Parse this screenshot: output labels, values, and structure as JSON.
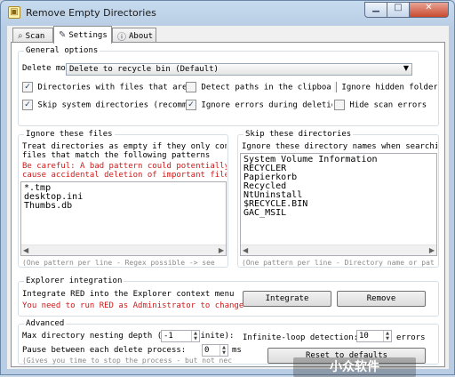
{
  "window": {
    "title": "Remove Empty Directories",
    "icon": "folder-icon",
    "controls": [
      "minimize-icon",
      "maximize-icon",
      "close-icon"
    ]
  },
  "tabs": [
    {
      "label": "Scan",
      "icon": "search-icon"
    },
    {
      "label": "Settings",
      "icon": "tools-icon",
      "active": true
    },
    {
      "label": "About",
      "icon": "info-icon"
    }
  ],
  "general": {
    "title": "General options",
    "delete_mode_label": "Delete mode:",
    "delete_mode_value": "Delete to recycle bin (Default)",
    "checkboxes": [
      {
        "label": "Directories with files that are 0 ",
        "checked": true
      },
      {
        "label": "Detect paths in the clipboard",
        "checked": false
      },
      {
        "label": "Ignore hidden folders",
        "checked": false
      },
      {
        "label": "Skip system directories (recommend",
        "checked": true
      },
      {
        "label": "Ignore errors during deletion",
        "checked": true
      },
      {
        "label": "Hide scan errors",
        "checked": false
      }
    ]
  },
  "ignore_files": {
    "title": "Ignore these files",
    "desc1": "Treat directories as empty if they only contai",
    "desc2": "files that match the following patterns",
    "warn1": "Be careful: A bad pattern could potentially",
    "warn2": "cause accidental deletion of important files.",
    "patterns": [
      "*.tmp",
      "desktop.ini",
      "Thumbs.db"
    ],
    "hint": "(One pattern per line - Regex possible -> see"
  },
  "skip_dirs": {
    "title": "Skip these directories",
    "desc": "Ignore these directory names when searching:",
    "dirs": [
      "System Volume Information",
      "RECYCLER",
      "Papierkorb",
      "Recycled",
      "NtUninstall",
      "$RECYCLE.BIN",
      "GAC_MSIL"
    ],
    "hint": "(One pattern per line - Directory name or pat"
  },
  "explorer": {
    "title": "Explorer integration",
    "desc": "Integrate RED into the Explorer context menu",
    "warn": "You need to run RED as Administrator to change this",
    "integrate_label": "Integrate",
    "remove_label": "Remove"
  },
  "advanced": {
    "title": "Advanced",
    "max_depth_label": "Max directory nesting depth (-1 = infinite):",
    "max_depth_value": "-1",
    "infinite_loop_label": "Infinite-loop detection: St",
    "infinite_loop_value": "10",
    "errors_label": "errors",
    "pause_label": "Pause between each delete process:",
    "pause_value": "0",
    "pause_unit": "ms",
    "note": "(Gives you time to stop the process - but not nec",
    "reset_label": "Reset to defaults"
  },
  "watermark": "小众软件"
}
